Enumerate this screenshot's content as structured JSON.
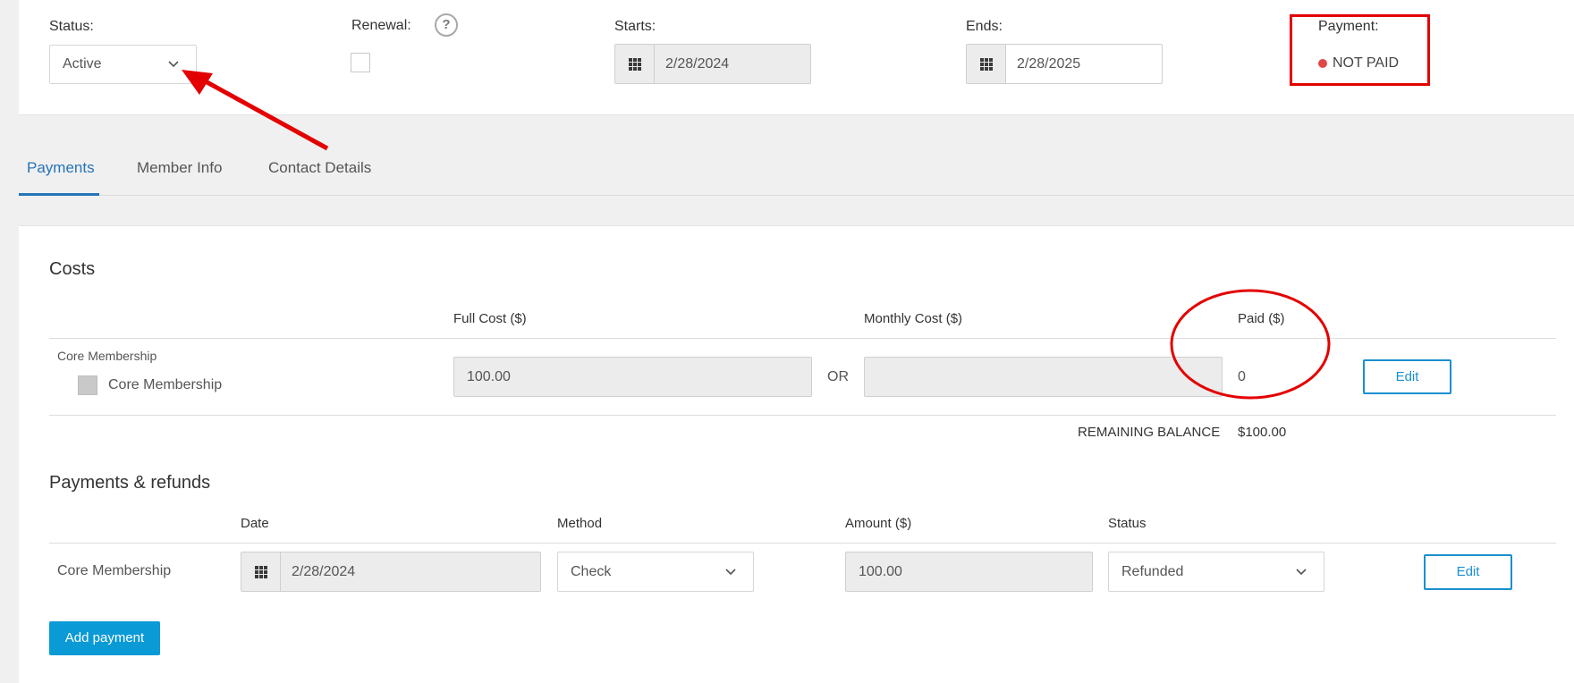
{
  "header": {
    "status_label": "Status:",
    "status_value": "Active",
    "renewal_label": "Renewal:",
    "help_glyph": "?",
    "starts_label": "Starts:",
    "starts_value": "2/28/2024",
    "ends_label": "Ends:",
    "ends_value": "2/28/2025",
    "payment_label": "Payment:",
    "payment_status": "NOT PAID"
  },
  "tabs": [
    {
      "label": "Payments",
      "active": true
    },
    {
      "label": "Member Info",
      "active": false
    },
    {
      "label": "Contact Details",
      "active": false
    }
  ],
  "costs": {
    "title": "Costs",
    "headers": {
      "full_cost": "Full Cost ($)",
      "monthly_cost": "Monthly Cost ($)",
      "paid": "Paid ($)"
    },
    "row": {
      "group": "Core Membership",
      "item": "Core Membership",
      "full_cost": "100.00",
      "or_label": "OR",
      "monthly_cost": "",
      "paid": "0",
      "edit_label": "Edit"
    },
    "remaining_label": "REMAINING BALANCE",
    "remaining_value": "$100.00"
  },
  "payments": {
    "title": "Payments & refunds",
    "headers": {
      "date": "Date",
      "method": "Method",
      "amount": "Amount ($)",
      "status": "Status"
    },
    "row": {
      "name": "Core Membership",
      "date": "2/28/2024",
      "method": "Check",
      "amount": "100.00",
      "status": "Refunded",
      "edit_label": "Edit"
    },
    "add_label": "Add payment"
  },
  "colors": {
    "accent": "#1a8fd0",
    "tab_active": "#2574b8",
    "annotation_red": "#e30000",
    "not_paid_dot": "#e04848"
  },
  "icons": [
    "chevron-down-icon",
    "calendar-grid-icon",
    "help-icon"
  ]
}
